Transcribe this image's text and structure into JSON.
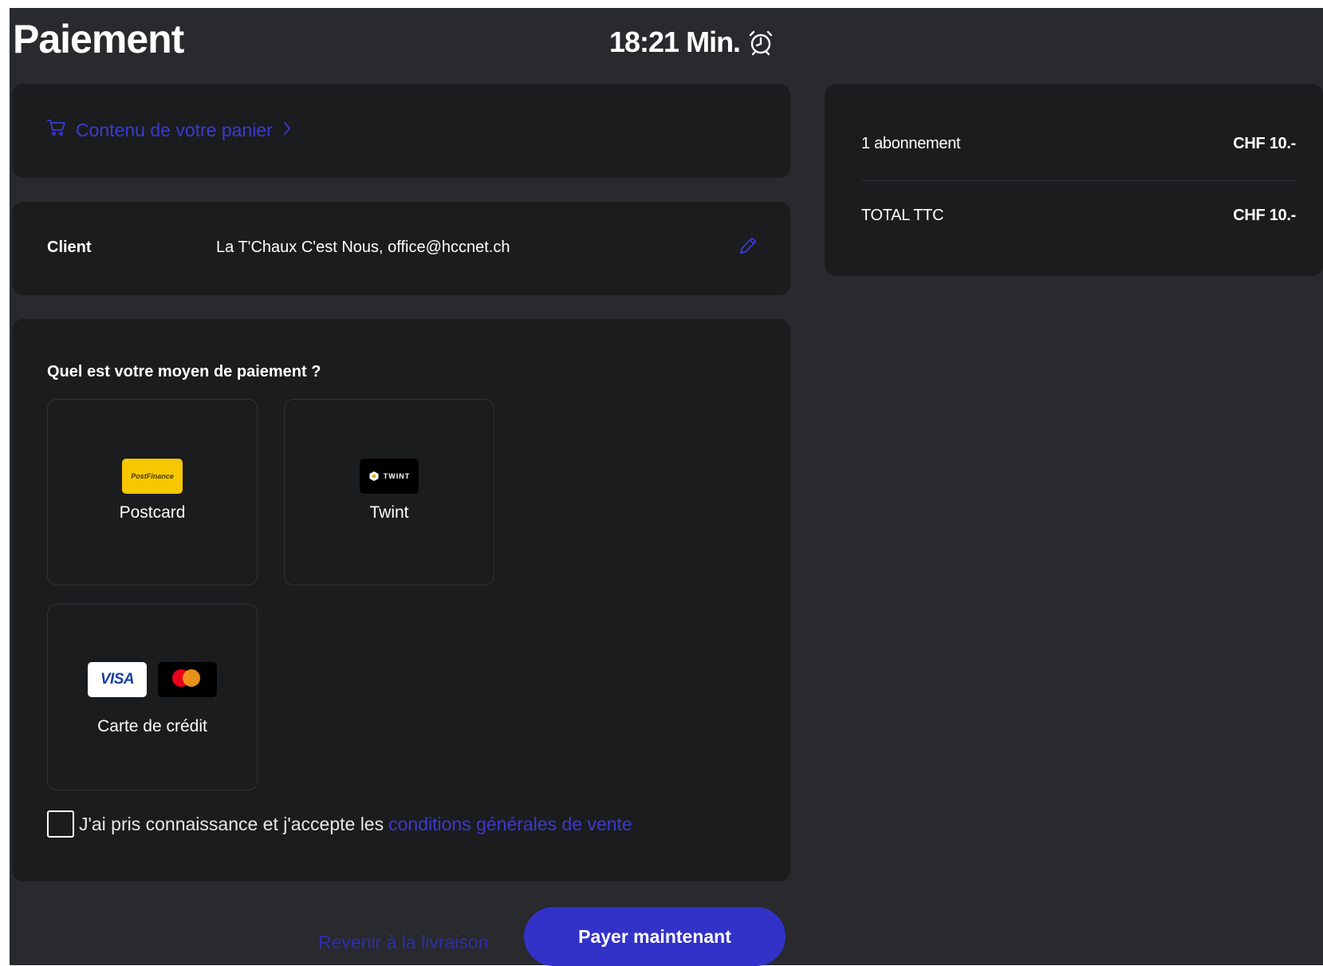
{
  "header": {
    "title": "Paiement",
    "timer": "18:21 Min."
  },
  "cart": {
    "link_label": "Contenu de votre panier"
  },
  "client": {
    "label": "Client",
    "value": "La T'Chaux C'est Nous, office@hccnet.ch"
  },
  "payment": {
    "question": "Quel est votre moyen de paiement ?",
    "methods": [
      {
        "label": "Postcard",
        "logo_text": "PostFinance"
      },
      {
        "label": "Twint",
        "logo_text": "TWINT"
      },
      {
        "label": "Carte de crédit",
        "logo_text": "VISA"
      }
    ],
    "terms_text": "J'ai pris connaissance et j'accepte les",
    "terms_link": "conditions générales de vente",
    "terms_checked": false
  },
  "actions": {
    "back_label": "Revenir à la livraison",
    "pay_label": "Payer maintenant"
  },
  "summary": {
    "rows": [
      {
        "label": "1 abonnement",
        "amount": "CHF 10.-"
      },
      {
        "label": "TOTAL TTC",
        "amount": "CHF 10.-"
      }
    ]
  },
  "colors": {
    "background": "#282a2d",
    "card": "#1b1c1e",
    "accent": "#3232c8",
    "link": "#3a3ad0"
  }
}
